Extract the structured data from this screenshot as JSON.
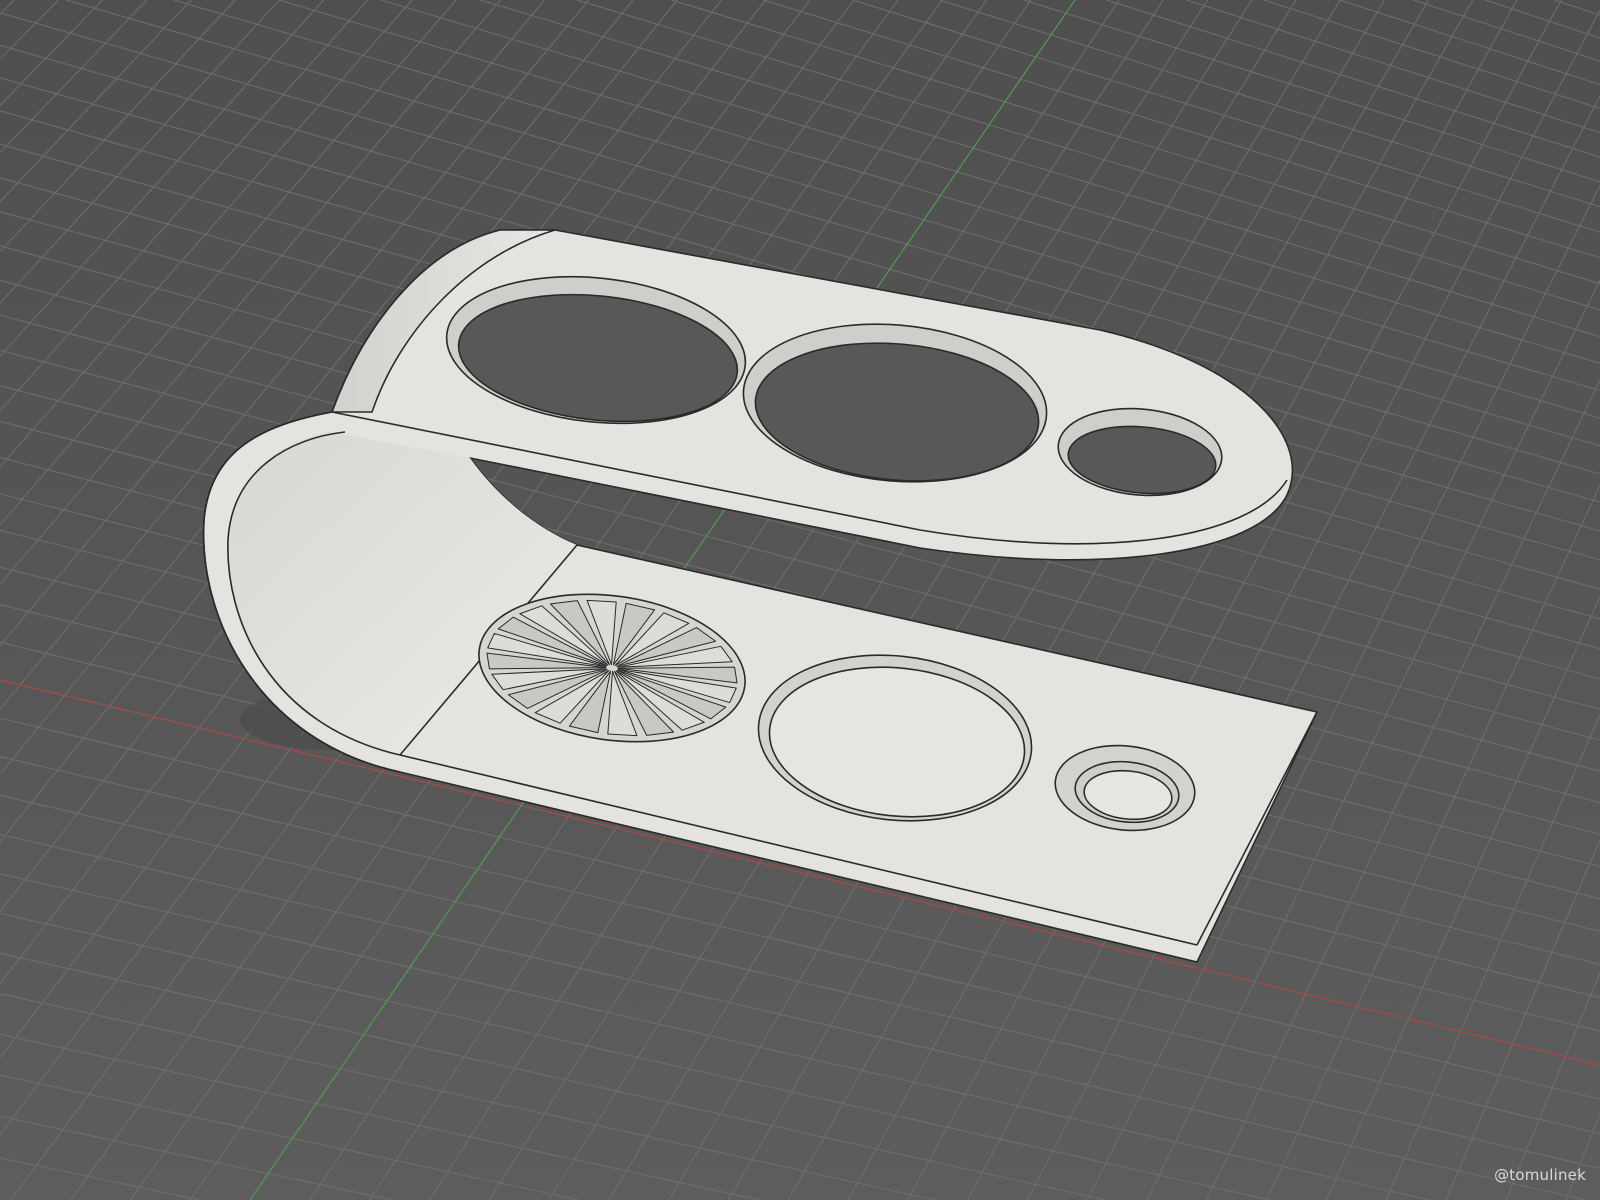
{
  "watermark": "@tomulinek",
  "colors": {
    "background": "#595959",
    "grid": "#6f6f6f",
    "x_axis": "#b24a4a",
    "y_axis": "#4f9a4f",
    "model": "#e4e3df",
    "model_shade": "#cfceca",
    "edge": "#2a2a2a"
  }
}
